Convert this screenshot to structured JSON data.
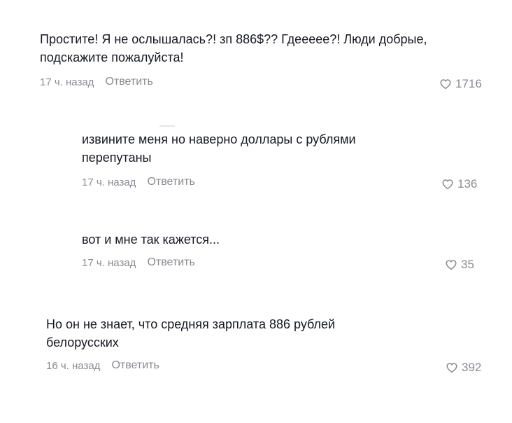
{
  "comments": [
    {
      "text": "Простите! Я не ослышалась?! зп 886$?? Гдеееее?! Люди добрые, подскажите пожалуйста!",
      "time": "17 ч. назад",
      "reply": "Ответить",
      "likes": "1716"
    },
    {
      "text": "извините меня но наверно доллары с рублями перепутаны",
      "time": "17 ч. назад",
      "reply": "Ответить",
      "likes": "136"
    },
    {
      "text": "вот и мне так кажется...",
      "time": "17 ч. назад",
      "reply": "Ответить",
      "likes": "35"
    },
    {
      "text": "Но он не знает, что средняя зарплата 886 рублей белорусских",
      "time": "16 ч. назад",
      "reply": "Ответить",
      "likes": "392"
    }
  ],
  "icons": {
    "like": "heart-outline-icon"
  }
}
